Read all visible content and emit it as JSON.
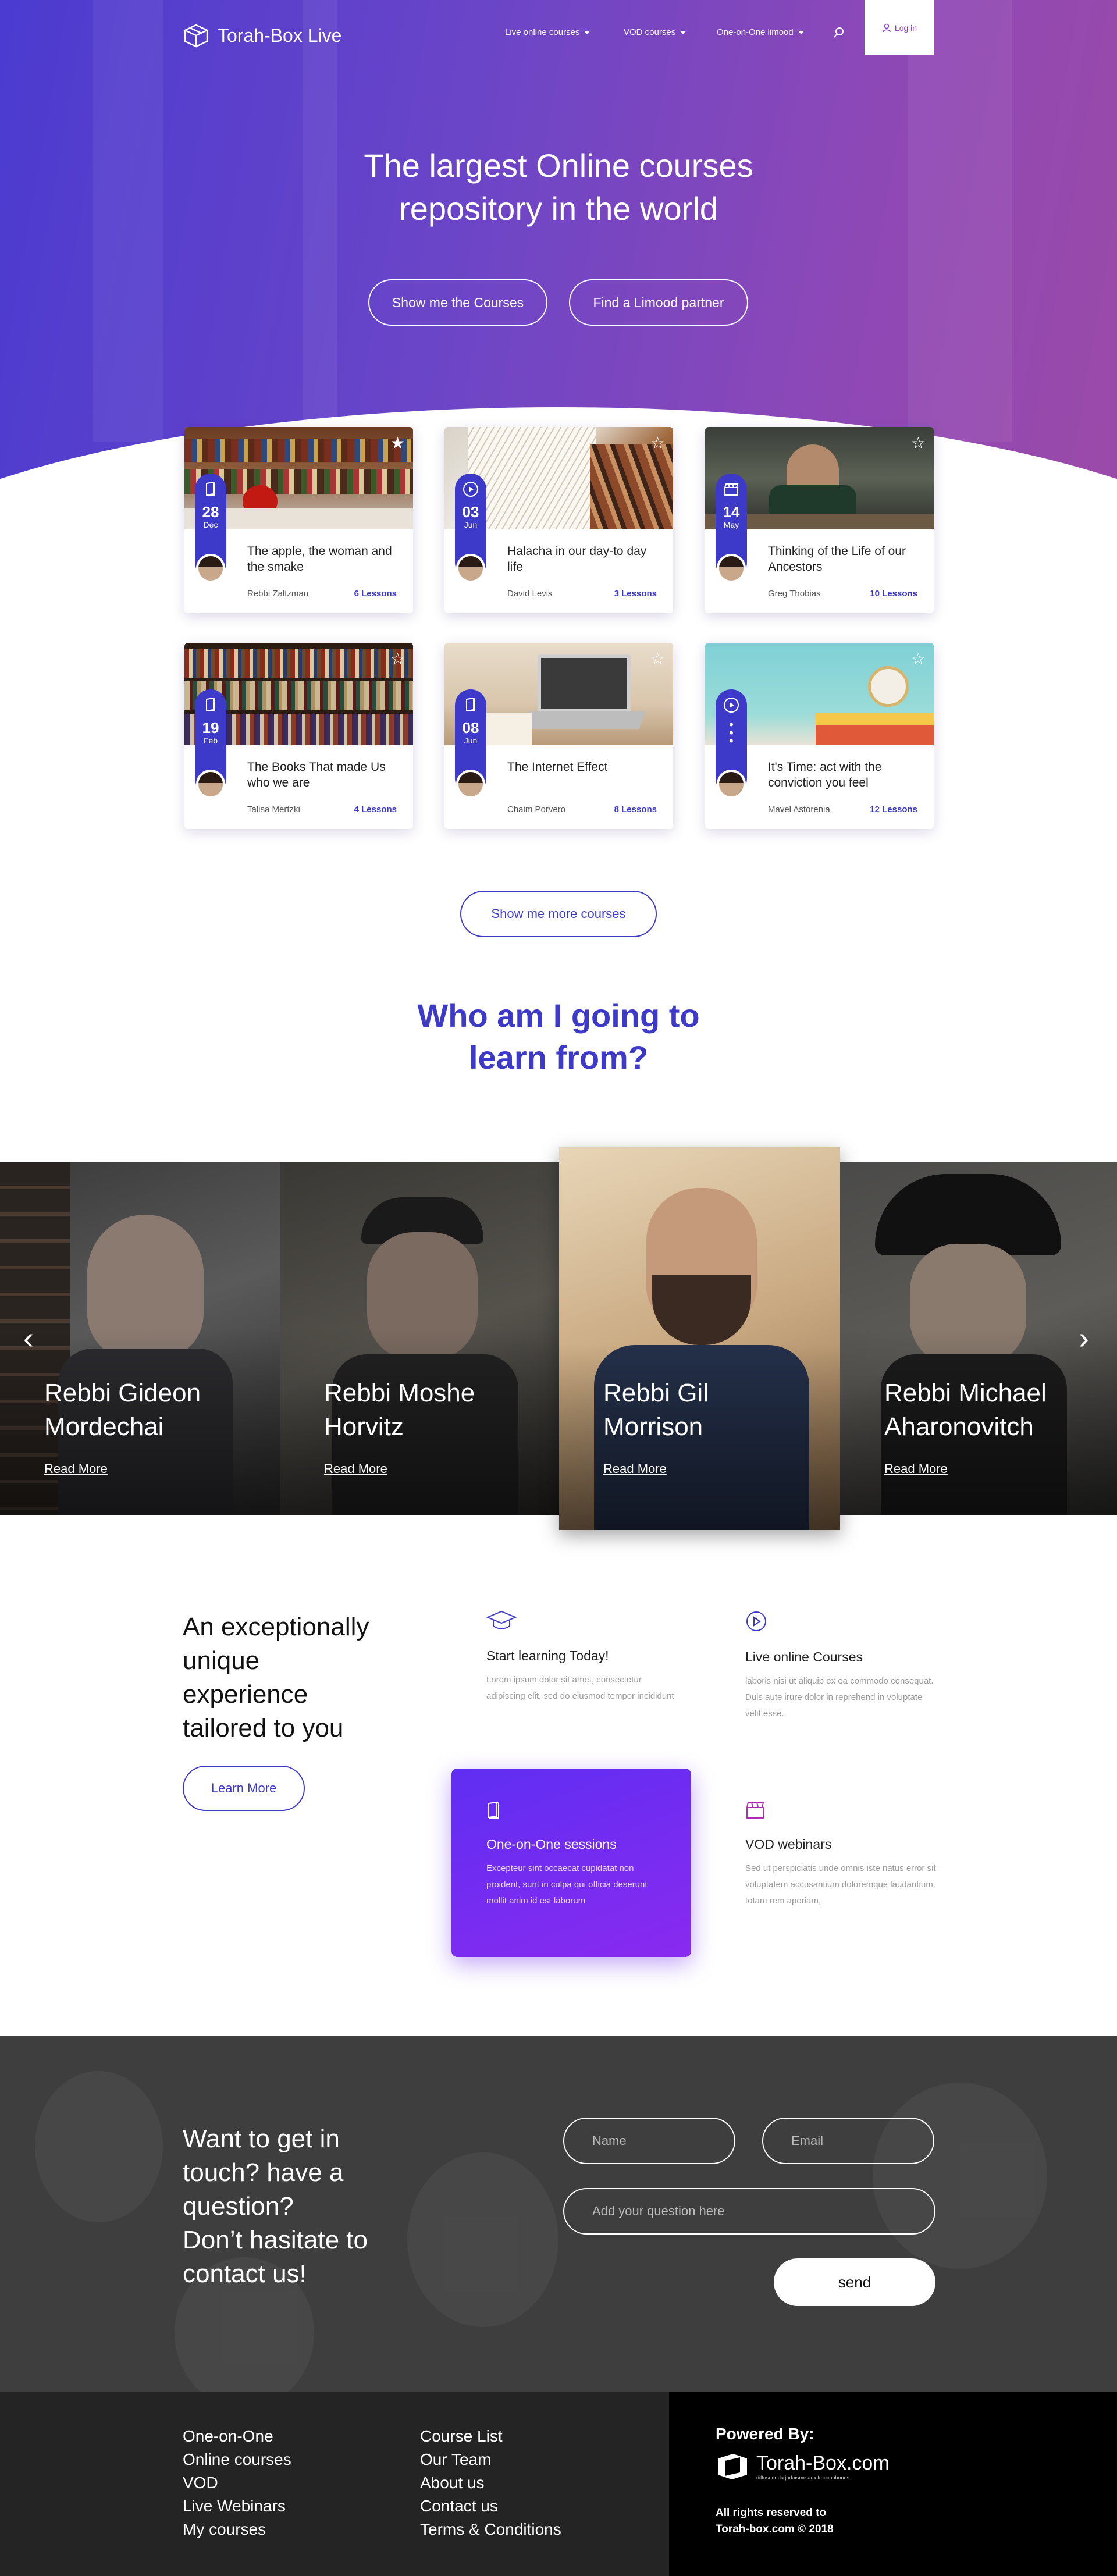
{
  "header": {
    "brand": "Torah-Box Live",
    "nav": [
      "Live online courses",
      "VOD courses",
      "One-on-One limood"
    ],
    "login_label": "Log in"
  },
  "hero": {
    "title_line1": "The largest Online courses",
    "title_line2": "repository in the world",
    "btn_courses": "Show me the Courses",
    "btn_partner": "Find a Limood partner"
  },
  "courses": [
    {
      "day": "28",
      "month": "Dec",
      "title": "The apple, the woman and the smake",
      "author": "Rebbi Zaltzman",
      "lessons": "6 Lessons",
      "icon": "book-icon"
    },
    {
      "day": "03",
      "month": "Jun",
      "title": "Halacha in our day-to day life",
      "author": "David Levis",
      "lessons": "3 Lessons",
      "icon": "play-icon"
    },
    {
      "day": "14",
      "month": "May",
      "title": "Thinking of the Life of our Ancestors",
      "author": "Greg Thobias",
      "lessons": "10 Lessons",
      "icon": "clapper-icon"
    },
    {
      "day": "19",
      "month": "Feb",
      "title": "The Books That made Us who we are",
      "author": "Talisa Mertzki",
      "lessons": "4 Lessons",
      "icon": "book-icon"
    },
    {
      "day": "08",
      "month": "Jun",
      "title": "The Internet Effect",
      "author": "Chaim Porvero",
      "lessons": "8 Lessons",
      "icon": "book-icon"
    },
    {
      "day": "",
      "month": "",
      "title": "It's Time: act with the conviction you feel",
      "author": "Mavel Astorenia",
      "lessons": "12 Lessons",
      "icon": "play-icon"
    }
  ],
  "more_courses_label": "Show me more courses",
  "who": {
    "line1": "Who am I going to",
    "line2": "learn from?"
  },
  "rabbis": [
    {
      "line1": "Rebbi Gideon",
      "line2": "Mordechai",
      "read_more": "Read More"
    },
    {
      "line1": "Rebbi Moshe",
      "line2": "Horvitz",
      "read_more": "Read More"
    },
    {
      "line1": "Rebbi Gil",
      "line2": "Morrison",
      "read_more": "Read More"
    },
    {
      "line1": "Rebbi Michael",
      "line2": "Aharonovitch",
      "read_more": "Read More"
    }
  ],
  "features": {
    "heading": [
      "An exceptionally",
      "unique",
      "experience",
      "tailored to you"
    ],
    "learn_more": "Learn More",
    "items": [
      {
        "icon": "graduation-cap-icon",
        "title": "Start learning Today!",
        "desc": "Lorem ipsum dolor sit amet, consectetur adipiscing elit, sed do eiusmod tempor incididunt"
      },
      {
        "icon": "play-circle-icon",
        "title": "Live online Courses",
        "desc": "laboris nisi ut aliquip ex ea commodo consequat. Duis aute irure dolor in reprehend in voluptate velit esse."
      },
      {
        "icon": "book-icon",
        "title": "One-on-One sessions",
        "desc": "Excepteur sint occaecat cupidatat non proident, sunt in culpa qui officia deserunt mollit anim id est laborum"
      },
      {
        "icon": "clapper-icon",
        "title": "VOD webinars",
        "desc": "Sed ut perspiciatis unde omnis iste natus error sit voluptatem accusantium doloremque laudantium, totam rem aperiam,"
      }
    ]
  },
  "contact": {
    "heading": [
      "Want to get in",
      "touch? have a",
      "question?",
      "Don’t hasitate to",
      "contact us!"
    ],
    "name_placeholder": "Name",
    "email_placeholder": "Email",
    "question_placeholder": "Add your question here",
    "send_label": "send"
  },
  "footer": {
    "col1": [
      "One-on-One",
      "Online courses",
      "VOD",
      "Live Webinars",
      "My courses"
    ],
    "col2": [
      "Course List",
      "Our Team",
      "About us",
      "Contact us",
      "Terms & Conditions"
    ],
    "powered_by": "Powered By:",
    "tb_brand": "Torah-Box.com",
    "tb_tagline": "diffuseur du judaïsme aux francophones",
    "rights_line1": "All rights reserved to",
    "rights_line2": "Torah-box.com © 2018"
  },
  "colors": {
    "accent": "#3d3ac9",
    "purple": "#8a2af0",
    "dark": "#3e3e3e"
  }
}
